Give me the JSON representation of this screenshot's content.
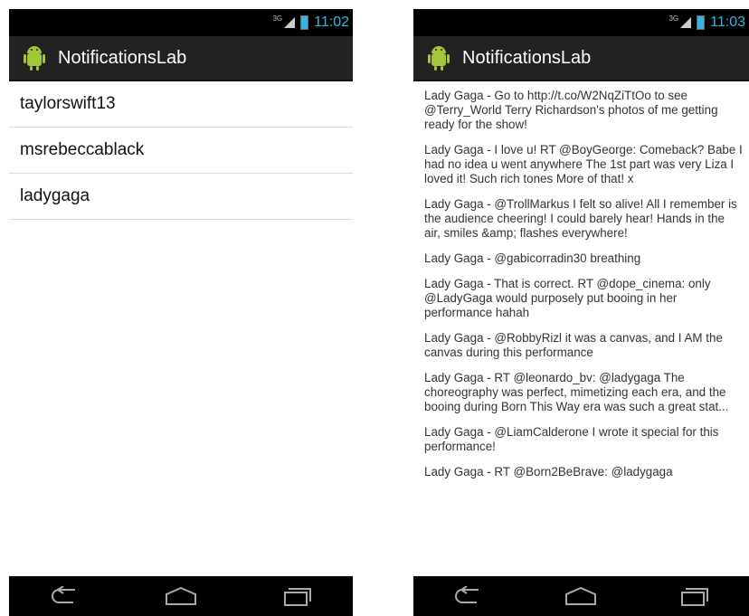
{
  "left_phone": {
    "status_bar": {
      "network": "3G",
      "time": "11:02"
    },
    "action_bar": {
      "title": "NotificationsLab"
    },
    "list": [
      "taylorswift13",
      "msrebeccablack",
      "ladygaga"
    ]
  },
  "right_phone": {
    "status_bar": {
      "network": "3G",
      "time": "11:03"
    },
    "action_bar": {
      "title": "NotificationsLab"
    },
    "tweets": [
      "Lady Gaga - Go to http://t.co/W2NqZiTtOo to see @Terry_World Terry Richardson's photos of me getting ready for the show!",
      "Lady Gaga - I love u! RT @BoyGeorge: Comeback? Babe I had no idea u went anywhere The 1st part was very Liza I loved it! Such rich tones More of that! x",
      "Lady Gaga - @TrollMarkus I felt so alive! All I remember is the audience cheering! I could barely hear! Hands in the air, smiles &amp; flashes everywhere!",
      "Lady Gaga - @gabicorradin30 breathing",
      "Lady Gaga - That is correct. RT @dope_cinema: only @LadyGaga would purposely put booing in her performance hahah",
      "Lady Gaga - @RobbyRizl it was a canvas, and I AM the canvas during this performance",
      "Lady Gaga - RT @leonardo_bv: @ladygaga The choreography was perfect, mimetizing each era, and the booing during Born This Way era was such a great stat...",
      "Lady Gaga - @LiamCalderone I wrote it special for this performance!",
      "Lady Gaga - RT @Born2BeBrave: @ladygaga"
    ]
  },
  "colors": {
    "status_bar_bg": "#000000",
    "action_bar_bg": "#222222",
    "accent": "#33b5e5",
    "nav_bar_bg": "#000000"
  },
  "icons": {
    "app": "android-robot-icon",
    "nav_back": "back-arrow-icon",
    "nav_home": "home-icon",
    "nav_recent": "recent-apps-icon"
  }
}
